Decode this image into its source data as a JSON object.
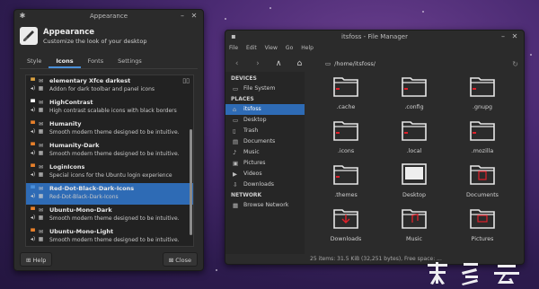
{
  "appearance": {
    "window_title": "Appearance",
    "header_title": "Appearance",
    "header_subtitle": "Customize the look of your desktop",
    "tabs": [
      "Style",
      "Icons",
      "Fonts",
      "Settings"
    ],
    "active_tab": "Icons",
    "themes": [
      {
        "name": "elementary Xfce darkest",
        "desc": "Addon for dark toolbar and panel icons",
        "selected": false
      },
      {
        "name": "HighContrast",
        "desc": "High contrast scalable icons with black borders",
        "selected": false
      },
      {
        "name": "Humanity",
        "desc": "Smooth modern theme designed to be intuitive.",
        "selected": false
      },
      {
        "name": "Humanity-Dark",
        "desc": "Smooth modern theme designed to be intuitive.",
        "selected": false
      },
      {
        "name": "LoginIcons",
        "desc": "Special icons for the Ubuntu login experience",
        "selected": false
      },
      {
        "name": "Red-Dot-Black-Dark-Icons",
        "desc": "Red-Dot-Black-Dark-Icons",
        "selected": true
      },
      {
        "name": "Ubuntu-Mono-Dark",
        "desc": "Smooth modern theme designed to be intuitive.",
        "selected": false
      },
      {
        "name": "Ubuntu-Mono-Light",
        "desc": "Smooth modern theme designed to be intuitive.",
        "selected": false
      }
    ],
    "help_label": "Help",
    "close_label": "Close"
  },
  "fm": {
    "window_title": "itsfoss - File Manager",
    "menu": [
      "File",
      "Edit",
      "View",
      "Go",
      "Help"
    ],
    "path": "/home/itsfoss/",
    "sidebar": {
      "devices_header": "DEVICES",
      "devices": [
        {
          "label": "File System",
          "icon": "drive-icon"
        }
      ],
      "places_header": "PLACES",
      "places": [
        {
          "label": "itsfoss",
          "icon": "home-icon",
          "active": true
        },
        {
          "label": "Desktop",
          "icon": "desktop-icon",
          "active": false
        },
        {
          "label": "Trash",
          "icon": "trash-icon",
          "active": false
        },
        {
          "label": "Documents",
          "icon": "documents-icon",
          "active": false
        },
        {
          "label": "Music",
          "icon": "music-icon",
          "active": false
        },
        {
          "label": "Pictures",
          "icon": "pictures-icon",
          "active": false
        },
        {
          "label": "Videos",
          "icon": "videos-icon",
          "active": false
        },
        {
          "label": "Downloads",
          "icon": "downloads-icon",
          "active": false
        }
      ],
      "network_header": "NETWORK",
      "network": [
        {
          "label": "Browse Network",
          "icon": "network-icon"
        }
      ]
    },
    "files": [
      {
        "name": ".cache",
        "kind": "folder"
      },
      {
        "name": ".config",
        "kind": "folder"
      },
      {
        "name": ".gnupg",
        "kind": "folder"
      },
      {
        "name": ".icons",
        "kind": "folder"
      },
      {
        "name": ".local",
        "kind": "folder"
      },
      {
        "name": ".mozilla",
        "kind": "folder"
      },
      {
        "name": ".themes",
        "kind": "folder"
      },
      {
        "name": "Desktop",
        "kind": "desktop"
      },
      {
        "name": "Documents",
        "kind": "documents"
      },
      {
        "name": "Downloads",
        "kind": "downloads"
      },
      {
        "name": "Music",
        "kind": "music"
      },
      {
        "name": "Pictures",
        "kind": "pictures"
      }
    ],
    "status": "25 items: 31.5 KiB (32,251 bytes), Free space: ..."
  },
  "watermark": "奥多云",
  "colors": {
    "accent": "#2e6bb5",
    "red_dot": "#e0202a"
  }
}
